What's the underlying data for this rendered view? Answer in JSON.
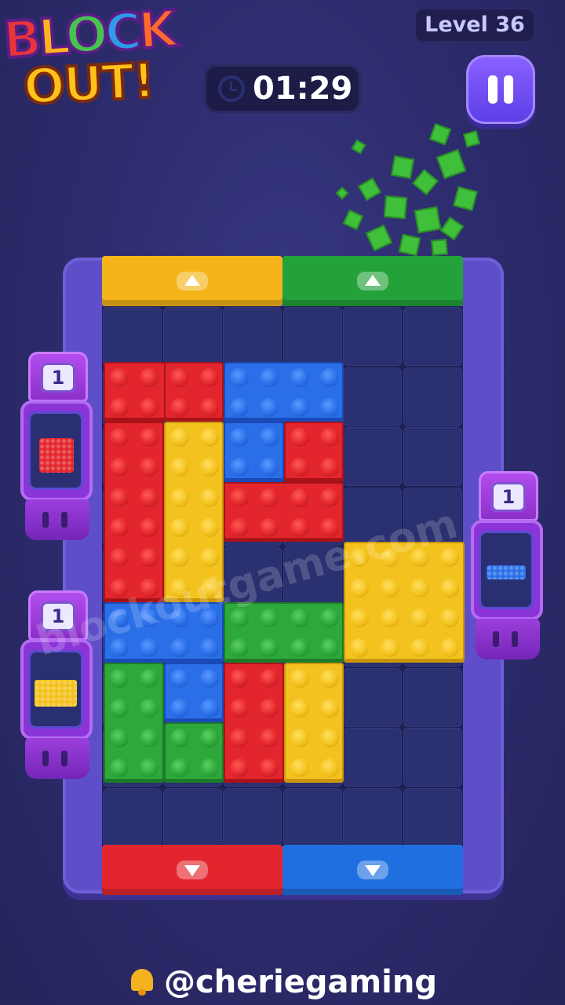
{
  "logo": {
    "line1": [
      "B",
      "L",
      "O",
      "C",
      "K"
    ],
    "line2": "OUT!"
  },
  "level": {
    "label": "Level 36"
  },
  "timer": {
    "value": "01:29"
  },
  "pause": {
    "icon": "pause-icon"
  },
  "gates": [
    {
      "color": "#f4b41a",
      "direction": "up"
    },
    {
      "color": "#23a23a",
      "direction": "up"
    },
    {
      "color": "#e3262d",
      "direction": "down"
    },
    {
      "color": "#1f6fe0",
      "direction": "down"
    }
  ],
  "machines": [
    {
      "count": "1",
      "block_color": "#e3262d"
    },
    {
      "count": "1",
      "block_color": "#2b6fe8"
    },
    {
      "count": "1",
      "block_color": "#f4c21e"
    }
  ],
  "watermark": "blockoutgame.com",
  "footer": {
    "handle": "@cheriegaming",
    "icon": "bell-icon"
  },
  "colors": {
    "red": "#e3262d",
    "yellow": "#f4c21e",
    "blue": "#2b6fe8",
    "green": "#2ea83b"
  }
}
